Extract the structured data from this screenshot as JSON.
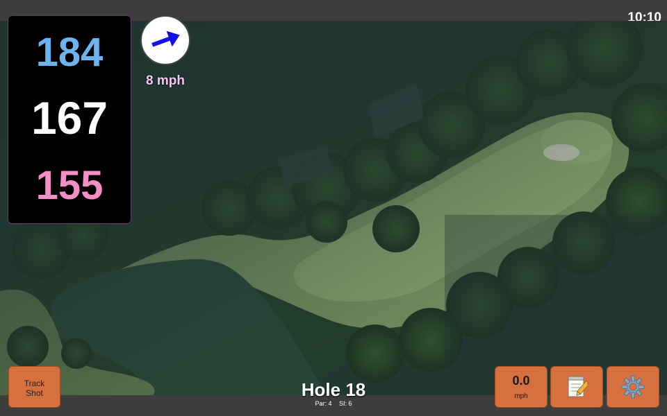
{
  "status_bar": {
    "time": "10:10"
  },
  "distances": {
    "back": "184",
    "center": "167",
    "front": "155"
  },
  "wind": {
    "speed_label": "8 mph",
    "direction_icon": "arrow-icon",
    "arrow_color": "#1010e8"
  },
  "hole": {
    "title": "Hole 18",
    "par_label": "Par: 4",
    "si_label": "SI: 6"
  },
  "buttons": {
    "track_shot_label": "Track\nShot",
    "speed_value": "0.0",
    "speed_unit": "mph",
    "notes_icon": "notepad-icon",
    "settings_icon": "gear-icon"
  },
  "colors": {
    "back_distance": "#6cb4f0",
    "center_distance": "#ffffff",
    "front_distance": "#f48fc6",
    "button_bg": "#d6703f"
  }
}
